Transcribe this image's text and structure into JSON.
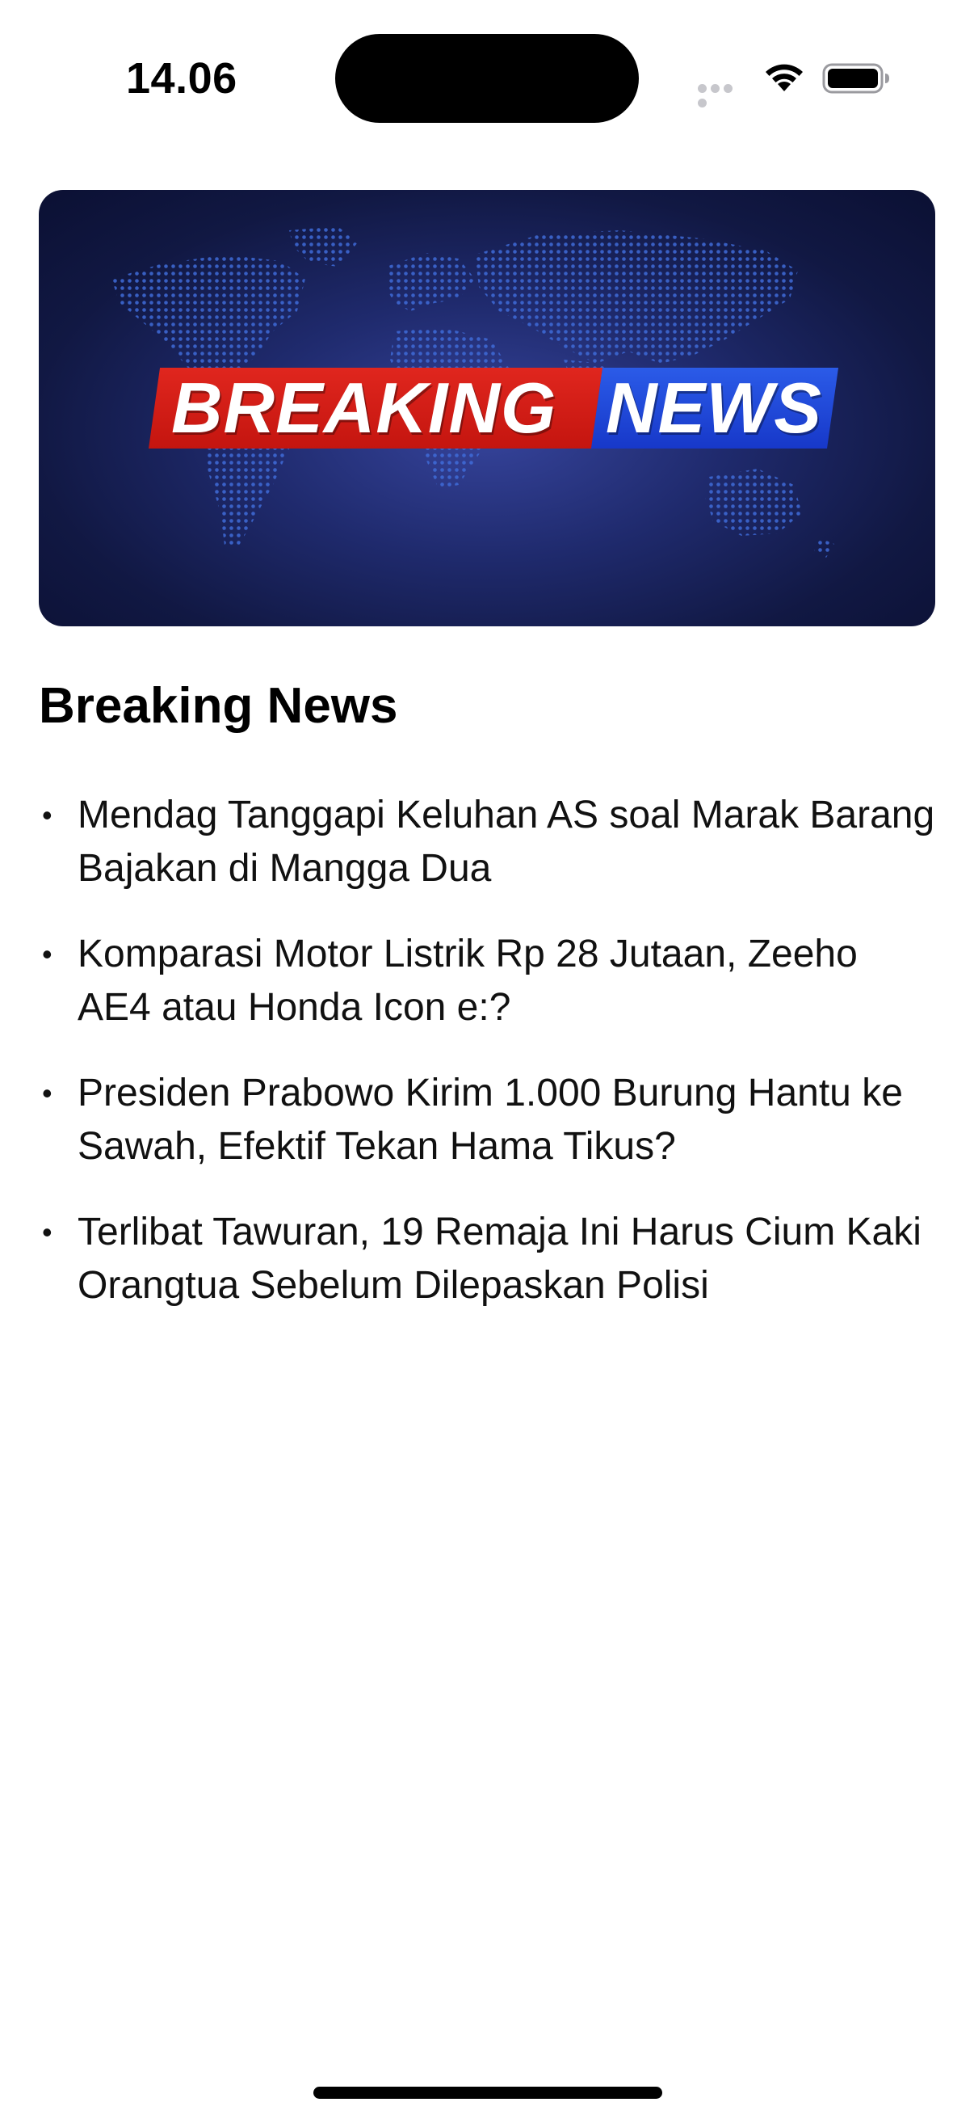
{
  "status_bar": {
    "time": "14.06"
  },
  "banner": {
    "word_breaking": "BREAKING",
    "word_news": "NEWS",
    "colors": {
      "red": "#d61d16",
      "blue": "#2249da",
      "background": "#1f2a6d"
    }
  },
  "section": {
    "title": "Breaking News"
  },
  "news": [
    {
      "bullet": "•",
      "title": "Mendag Tanggapi Keluhan AS soal Marak Barang Bajakan di Mangga Dua"
    },
    {
      "bullet": "•",
      "title": "Komparasi Motor Listrik Rp 28 Jutaan, Zeeho AE4 atau Honda Icon e:?"
    },
    {
      "bullet": "•",
      "title": "Presiden Prabowo Kirim 1.000 Burung Hantu ke Sawah, Efektif Tekan Hama Tikus?"
    },
    {
      "bullet": "•",
      "title": "Terlibat Tawuran, 19 Remaja Ini Harus Cium Kaki Orangtua Sebelum Dilepaskan Polisi"
    }
  ]
}
